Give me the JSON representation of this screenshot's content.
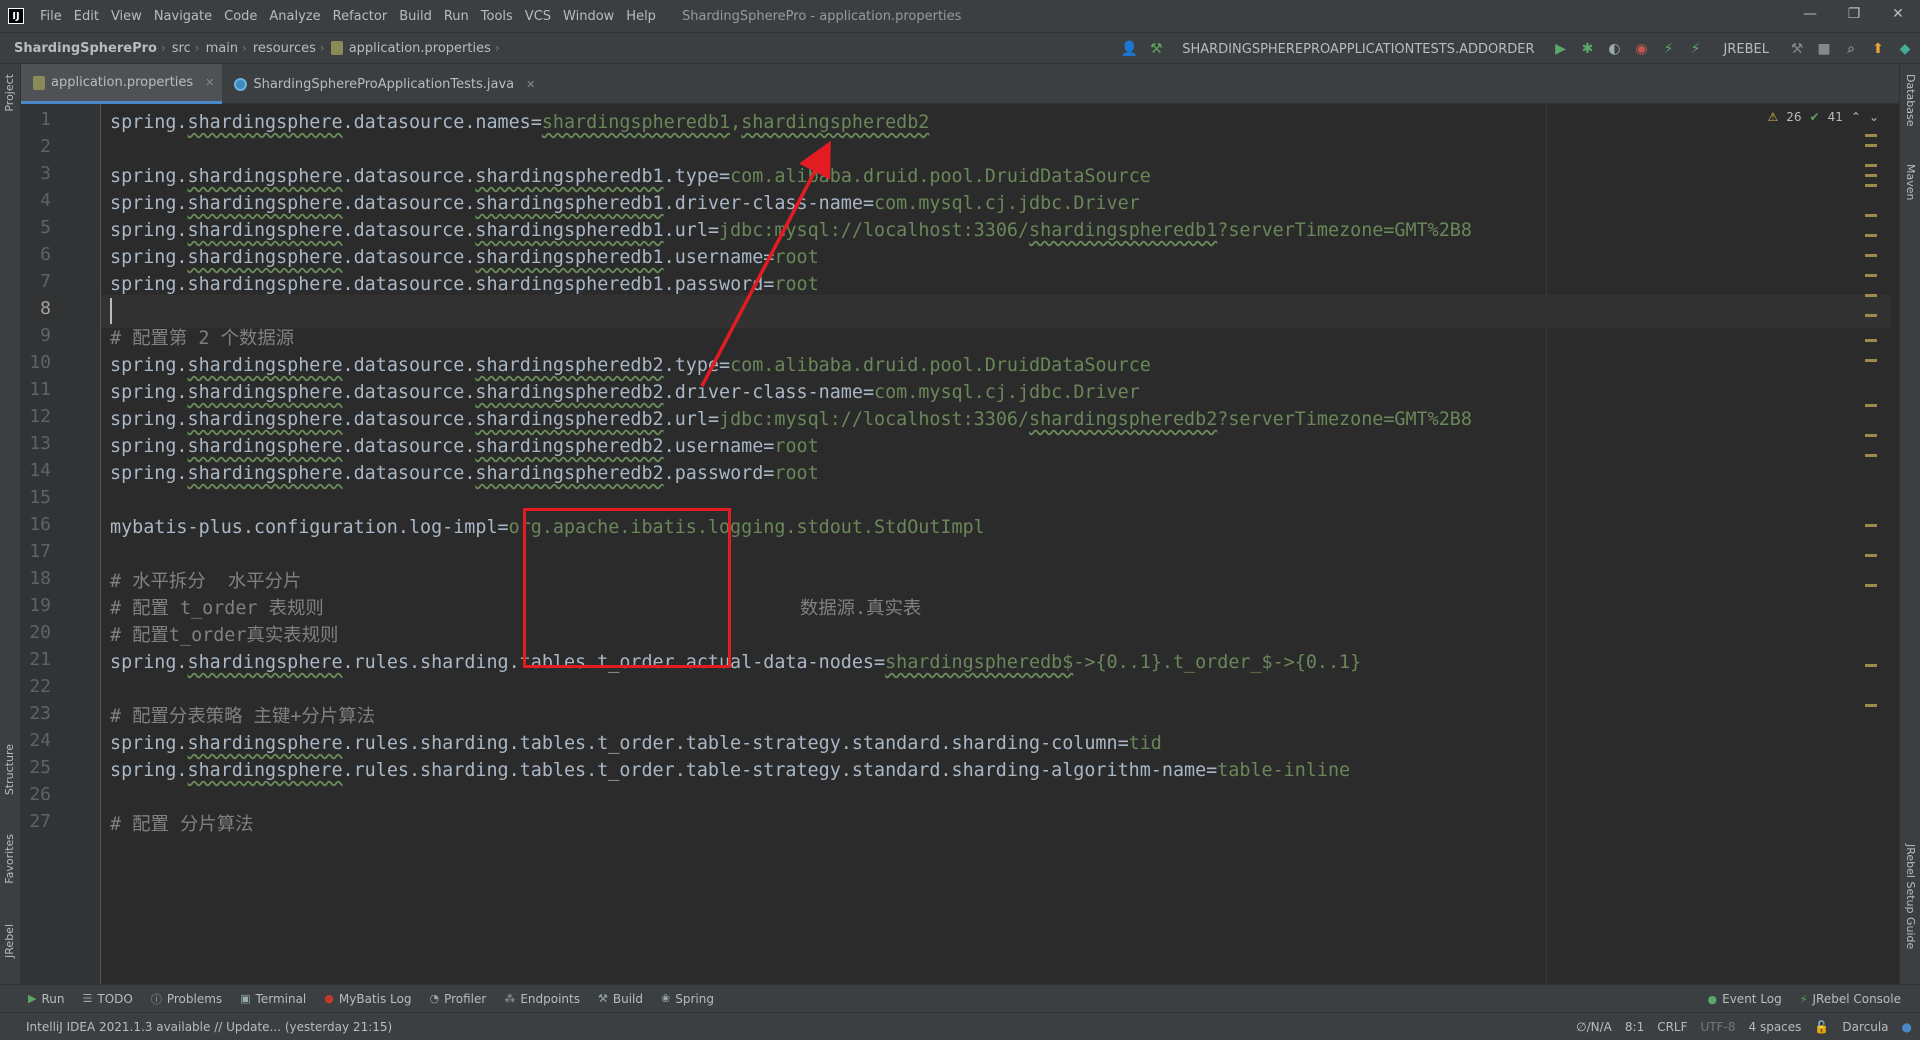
{
  "menubar": {
    "app_logo": "IJ",
    "items": [
      "File",
      "Edit",
      "View",
      "Navigate",
      "Code",
      "Analyze",
      "Refactor",
      "Build",
      "Run",
      "Tools",
      "VCS",
      "Window",
      "Help"
    ],
    "window_title": "ShardingSpherePro - application.properties"
  },
  "breadcrumbs": [
    "ShardingSpherePro",
    "src",
    "main",
    "resources",
    "application.properties"
  ],
  "toolbar": {
    "run_config": "SHARDINGSPHEREPROAPPLICATIONTESTS.ADDORDER",
    "jrebel": "JREBEL"
  },
  "tabs": [
    {
      "label": "application.properties",
      "active": true,
      "icon": "properties-file-icon"
    },
    {
      "label": "ShardingSphereProApplicationTests.java",
      "active": false,
      "icon": "java-class-icon"
    }
  ],
  "inspections": {
    "warnings": "26",
    "ok": "41"
  },
  "left_strip": [
    "Project",
    "Structure",
    "Favorites",
    "JRebel"
  ],
  "right_strip": [
    "Database",
    "Maven",
    "JRebel Setup Guide"
  ],
  "editor": {
    "current_line": 8,
    "lines": [
      {
        "n": "1",
        "text": "spring.shardingsphere.datasource.names=shardingspheredb1,shardingspheredb2"
      },
      {
        "n": "2",
        "text": ""
      },
      {
        "n": "3",
        "text": "spring.shardingsphere.datasource.shardingspheredb1.type=com.alibaba.druid.pool.DruidDataSource"
      },
      {
        "n": "4",
        "text": "spring.shardingsphere.datasource.shardingspheredb1.driver-class-name=com.mysql.cj.jdbc.Driver"
      },
      {
        "n": "5",
        "text": "spring.shardingsphere.datasource.shardingspheredb1.url=jdbc:mysql://localhost:3306/shardingspheredb1?serverTimezone=GMT%2B8"
      },
      {
        "n": "6",
        "text": "spring.shardingsphere.datasource.shardingspheredb1.username=root"
      },
      {
        "n": "7",
        "text": "spring.shardingsphere.datasource.shardingspheredb1.password=root"
      },
      {
        "n": "8",
        "text": ""
      },
      {
        "n": "9",
        "text": "# 配置第 2 个数据源"
      },
      {
        "n": "10",
        "text": "spring.shardingsphere.datasource.shardingspheredb2.type=com.alibaba.druid.pool.DruidDataSource"
      },
      {
        "n": "11",
        "text": "spring.shardingsphere.datasource.shardingspheredb2.driver-class-name=com.mysql.cj.jdbc.Driver"
      },
      {
        "n": "12",
        "text": "spring.shardingsphere.datasource.shardingspheredb2.url=jdbc:mysql://localhost:3306/shardingspheredb2?serverTimezone=GMT%2B8"
      },
      {
        "n": "13",
        "text": "spring.shardingsphere.datasource.shardingspheredb2.username=root"
      },
      {
        "n": "14",
        "text": "spring.shardingsphere.datasource.shardingspheredb2.password=root"
      },
      {
        "n": "15",
        "text": ""
      },
      {
        "n": "16",
        "text": "mybatis-plus.configuration.log-impl=org.apache.ibatis.logging.stdout.StdOutImpl"
      },
      {
        "n": "17",
        "text": ""
      },
      {
        "n": "18",
        "text": "# 水平拆分  水平分片"
      },
      {
        "n": "19",
        "text": "# 配置 t_order 表规则                                           数据源.真实表"
      },
      {
        "n": "20",
        "text": "# 配置t_order真实表规则"
      },
      {
        "n": "21",
        "text": "spring.shardingsphere.rules.sharding.tables.t_order.actual-data-nodes=shardingspheredb$->{0..1}.t_order_$->{0..1}"
      },
      {
        "n": "22",
        "text": ""
      },
      {
        "n": "23",
        "text": "# 配置分表策略 主键+分片算法"
      },
      {
        "n": "24",
        "text": "spring.shardingsphere.rules.sharding.tables.t_order.table-strategy.standard.sharding-column=tid"
      },
      {
        "n": "25",
        "text": "spring.shardingsphere.rules.sharding.tables.t_order.table-strategy.standard.sharding-algorithm-name=table-inline"
      },
      {
        "n": "26",
        "text": ""
      },
      {
        "n": "27",
        "text": "# 配置 分片算法"
      }
    ]
  },
  "tool_windows": [
    {
      "label": "Run",
      "icon": "run-icon"
    },
    {
      "label": "TODO",
      "icon": "todo-icon"
    },
    {
      "label": "Problems",
      "icon": "problems-icon"
    },
    {
      "label": "Terminal",
      "icon": "terminal-icon"
    },
    {
      "label": "MyBatis Log",
      "icon": "mybatis-icon"
    },
    {
      "label": "Profiler",
      "icon": "profiler-icon"
    },
    {
      "label": "Endpoints",
      "icon": "endpoints-icon"
    },
    {
      "label": "Build",
      "icon": "build-icon"
    },
    {
      "label": "Spring",
      "icon": "spring-icon"
    }
  ],
  "tool_windows_right": [
    "Event Log",
    "JRebel Console"
  ],
  "statusbar": {
    "message": "IntelliJ IDEA 2021.1.3 available // Update... (yesterday 21:15)",
    "vcs": "∅/N/A",
    "position": "8:1",
    "line_sep": "CRLF",
    "encoding": "UTF-8",
    "indent": "4 spaces",
    "theme": "Darcula"
  },
  "colors": {
    "highlight": "#e31c23",
    "accent": "#4a88c7"
  }
}
